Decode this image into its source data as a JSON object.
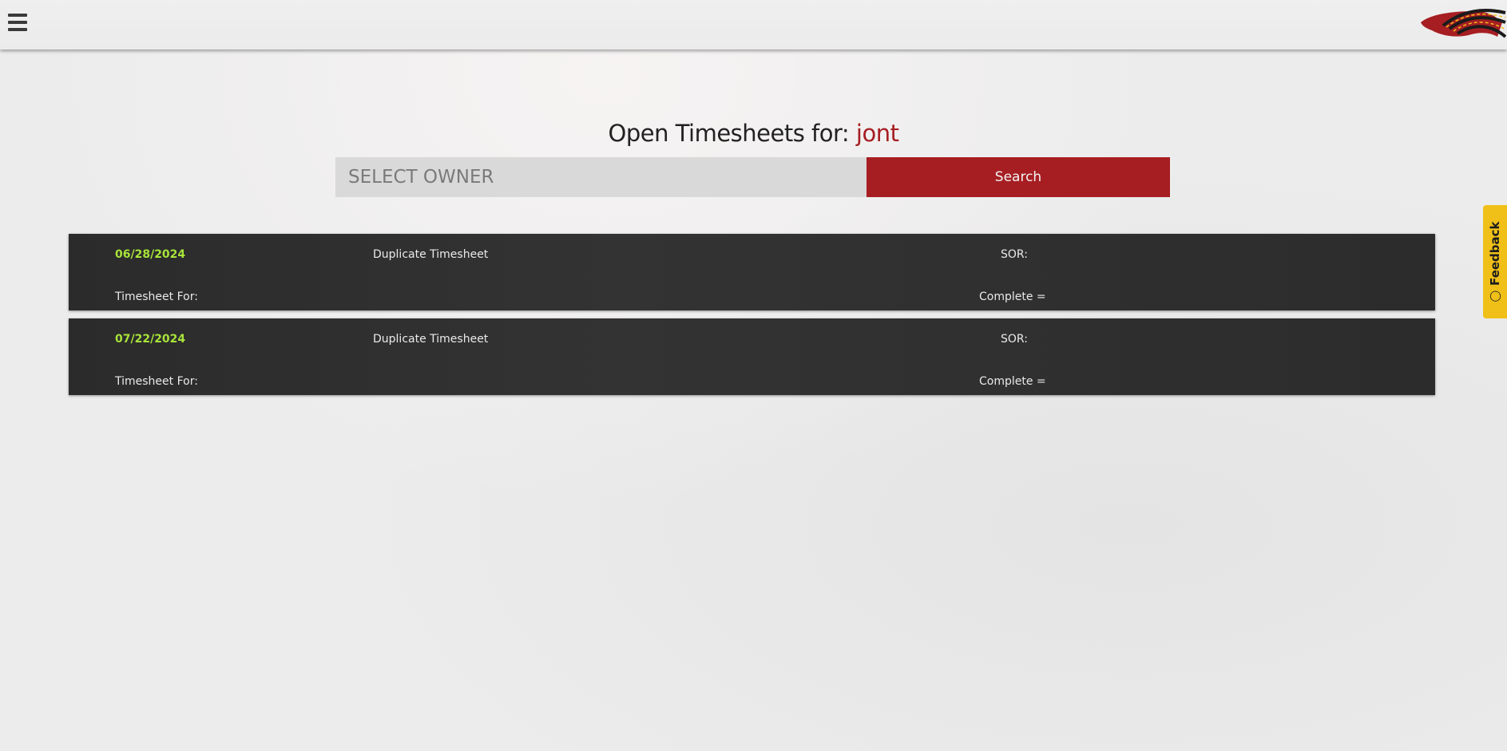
{
  "header": {
    "menu_icon": "hamburger-menu-icon",
    "logo_icon": "company-logo"
  },
  "page": {
    "title_prefix": "Open Timesheets for:",
    "owner_name": "jont"
  },
  "search": {
    "placeholder": "SELECT OWNER",
    "button_label": "Search"
  },
  "timesheets": [
    {
      "date": "06/28/2024",
      "action": "Duplicate Timesheet",
      "sor_label": "SOR:",
      "for_label": "Timesheet For:",
      "complete_label": "Complete ="
    },
    {
      "date": "07/22/2024",
      "action": "Duplicate Timesheet",
      "sor_label": "SOR:",
      "for_label": "Timesheet For:",
      "complete_label": "Complete ="
    }
  ],
  "feedback": {
    "label": "Feedback",
    "icon": "lightbulb-icon"
  },
  "colors": {
    "accent_red": "#a61e22",
    "date_green": "#a8e33a",
    "card_bg": "#2f2f2f",
    "feedback_yellow": "#f0c018"
  }
}
